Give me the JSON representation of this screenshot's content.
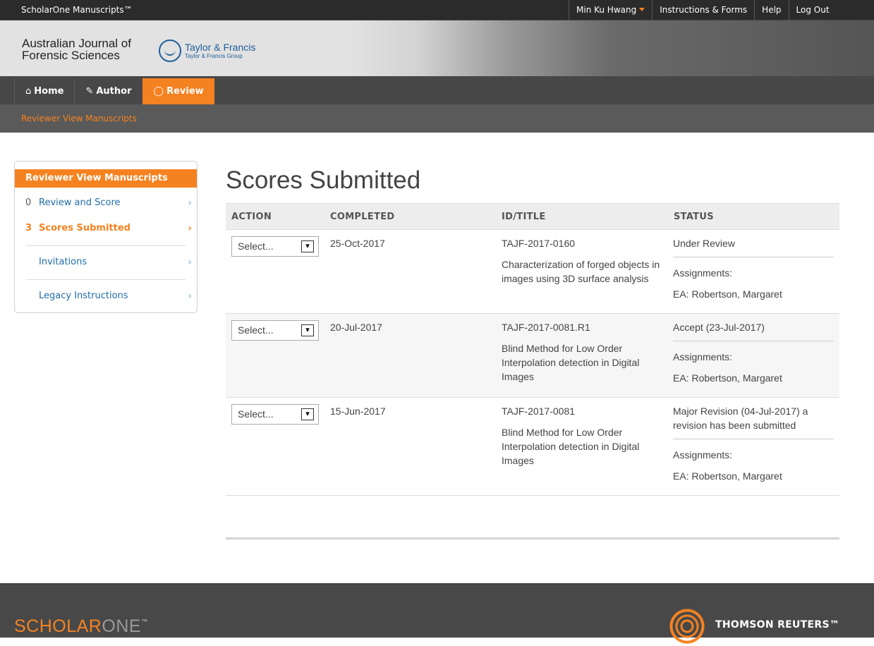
{
  "topbar": {
    "brand": "ScholarOne Manuscripts™",
    "user": "Min Ku Hwang",
    "instructions": "Instructions & Forms",
    "help": "Help",
    "logout": "Log Out"
  },
  "journal": {
    "title_line1": "Australian Journal of",
    "title_line2": "Forensic Sciences",
    "publisher": "Taylor & Francis",
    "publisher_group": "Taylor & Francis Group"
  },
  "nav": {
    "home": "Home",
    "author": "Author",
    "review": "Review"
  },
  "breadcrumb": "Reviewer View Manuscripts",
  "sidebar": {
    "header": "Reviewer View Manuscripts",
    "items": [
      {
        "count": "0",
        "label": "Review and Score"
      },
      {
        "count": "3",
        "label": "Scores Submitted"
      },
      {
        "count": "",
        "label": "Invitations"
      },
      {
        "count": "",
        "label": "Legacy Instructions"
      }
    ]
  },
  "main": {
    "title": "Scores Submitted",
    "columns": [
      "ACTION",
      "COMPLETED",
      "ID/TITLE",
      "STATUS"
    ],
    "rows": [
      {
        "action": "Select...",
        "completed": "25-Oct-2017",
        "id": "TAJF-2017-0160",
        "title": "Characterization of forged objects in images using 3D surface analysis",
        "status": "Under Review",
        "assignments_label": "Assignments:",
        "assignment": "EA: Robertson, Margaret"
      },
      {
        "action": "Select...",
        "completed": "20-Jul-2017",
        "id": "TAJF-2017-0081.R1",
        "title": "Blind Method for Low Order Interpolation detection in Digital Images",
        "status": "Accept (23-Jul-2017)",
        "assignments_label": "Assignments:",
        "assignment": "EA: Robertson, Margaret"
      },
      {
        "action": "Select...",
        "completed": "15-Jun-2017",
        "id": "TAJF-2017-0081",
        "title": "Blind Method for Low Order Interpolation detection in Digital Images",
        "status": "Major Revision (04-Jul-2017) a revision has been submitted",
        "assignments_label": "Assignments:",
        "assignment": "EA: Robertson, Margaret"
      }
    ]
  },
  "footer": {
    "scholar": "SCHOLAR",
    "one": "ONE",
    "tm": "™",
    "thomson": "THOMSON REUTERS™"
  },
  "colors": {
    "accent": "#f58220",
    "link": "#1f6da8",
    "topbar": "#2b2b2b",
    "nav": "#474747"
  },
  "icons": {
    "home": "home-icon",
    "author": "pencil-icon",
    "review": "comment-icon",
    "chevron": "chevron-right-icon",
    "dropdown": "chevron-down-icon"
  }
}
